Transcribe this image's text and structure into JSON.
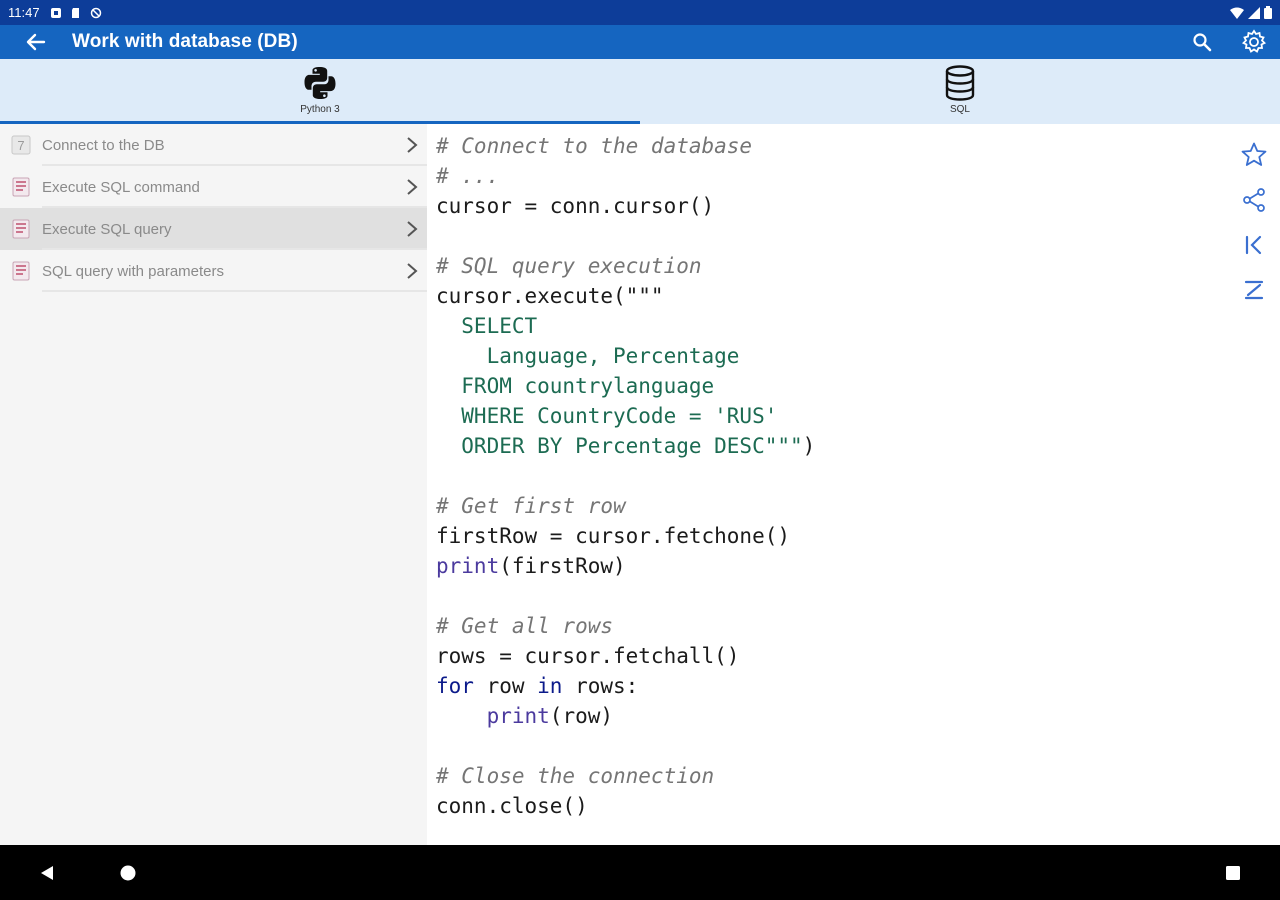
{
  "status_bar": {
    "time": "11:47",
    "left_icons": [
      "notification-icon",
      "sd-card-icon",
      "sync-icon"
    ],
    "right_icons": [
      "wifi-icon",
      "signal-icon",
      "battery-icon"
    ]
  },
  "app_bar": {
    "title": "Work with database (DB)",
    "back_icon": "arrow-back-icon",
    "actions": [
      "search-icon",
      "settings-icon"
    ]
  },
  "tabs": [
    {
      "label": "Python 3",
      "icon": "python-logo-icon",
      "selected": true
    },
    {
      "label": "SQL",
      "icon": "database-icon",
      "selected": false
    }
  ],
  "sidebar": {
    "items": [
      {
        "label": "Connect to the DB",
        "icon": "number-seven-icon",
        "active": false
      },
      {
        "label": "Execute SQL command",
        "icon": "sql-doc-icon",
        "active": false
      },
      {
        "label": "Execute SQL query",
        "icon": "sql-doc-icon",
        "active": true
      },
      {
        "label": "SQL query with parameters",
        "icon": "sql-doc-icon",
        "active": false
      }
    ]
  },
  "code": {
    "lines": [
      [
        {
          "t": "# Connect to the database",
          "c": "cm"
        }
      ],
      [
        {
          "t": "# ...",
          "c": "cm"
        }
      ],
      [
        {
          "t": "cursor = conn.cursor()",
          "c": ""
        }
      ],
      [],
      [
        {
          "t": "# SQL query execution",
          "c": "cm"
        }
      ],
      [
        {
          "t": "cursor.execute(\"\"\"",
          "c": ""
        }
      ],
      [
        {
          "t": "  SELECT",
          "c": "sq"
        }
      ],
      [
        {
          "t": "    Language, Percentage",
          "c": "sq"
        }
      ],
      [
        {
          "t": "  FROM countrylanguage",
          "c": "sq"
        }
      ],
      [
        {
          "t": "  WHERE CountryCode = 'RUS'",
          "c": "sq"
        }
      ],
      [
        {
          "t": "  ORDER BY Percentage DESC\"\"\"",
          "c": "sq"
        },
        {
          "t": ")",
          "c": ""
        }
      ],
      [],
      [
        {
          "t": "# Get first row",
          "c": "cm"
        }
      ],
      [
        {
          "t": "firstRow = cursor.fetchone()",
          "c": ""
        }
      ],
      [
        {
          "t": "print",
          "c": "fn"
        },
        {
          "t": "(firstRow)",
          "c": ""
        }
      ],
      [],
      [
        {
          "t": "# Get all rows",
          "c": "cm"
        }
      ],
      [
        {
          "t": "rows = cursor.fetchall()",
          "c": ""
        }
      ],
      [
        {
          "t": "for",
          "c": "kw"
        },
        {
          "t": " row ",
          "c": ""
        },
        {
          "t": "in",
          "c": "kw"
        },
        {
          "t": " rows:",
          "c": ""
        }
      ],
      [
        {
          "t": "    ",
          "c": ""
        },
        {
          "t": "print",
          "c": "fn"
        },
        {
          "t": "(row)",
          "c": ""
        }
      ],
      [],
      [
        {
          "t": "# Close the connection",
          "c": "cm"
        }
      ],
      [
        {
          "t": "conn.close()",
          "c": ""
        }
      ]
    ]
  },
  "right_tools": [
    "star-icon",
    "share-icon",
    "first-page-icon",
    "last-page-icon"
  ],
  "nav_bar": [
    "nav-back-icon",
    "nav-home-icon",
    "nav-recents-icon"
  ],
  "colors": {
    "status_bar": "#0d3d99",
    "app_bar": "#1565c0",
    "tab_background": "#ddebf9",
    "accent": "#1565c0",
    "sidebar_background": "#f5f5f5",
    "sidebar_active": "#e0e0e0",
    "code_comment": "#757575",
    "code_sql": "#1c6b52",
    "code_keyword": "#0b1a8a",
    "code_builtin": "#4b3a9e"
  }
}
